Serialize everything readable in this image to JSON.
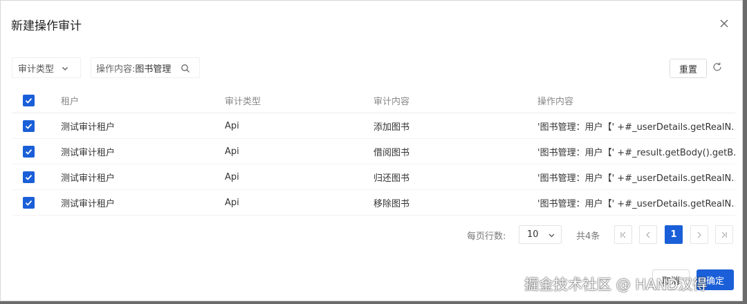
{
  "dialog": {
    "title": "新建操作审计"
  },
  "filters": {
    "type_label": "审计类型",
    "search_key": "操作内容:",
    "search_value": "图书管理"
  },
  "toolbar": {
    "reset_label": "重置"
  },
  "table": {
    "columns": [
      "租户",
      "审计类型",
      "审计内容",
      "操作内容"
    ],
    "rows": [
      {
        "checked": true,
        "tenant": "测试审计租户",
        "type": "Api",
        "content": "添加图书",
        "operation": "'图书管理：用户【' +#_userDetails.getRealN..."
      },
      {
        "checked": true,
        "tenant": "测试审计租户",
        "type": "Api",
        "content": "借阅图书",
        "operation": "'图书管理：用户【' +#_result.getBody().getB..."
      },
      {
        "checked": true,
        "tenant": "测试审计租户",
        "type": "Api",
        "content": "归还图书",
        "operation": "'图书管理：用户【' +#_userDetails.getRealN..."
      },
      {
        "checked": true,
        "tenant": "测试审计租户",
        "type": "Api",
        "content": "移除图书",
        "operation": "'图书管理：用户【' +#_userDetails.getRealN..."
      }
    ]
  },
  "pagination": {
    "page_size_label": "每页行数:",
    "page_size": "10",
    "total": "共4条",
    "current_page": "1"
  },
  "footer": {
    "cancel_label": "取消",
    "ok_label": "确定"
  },
  "watermark": "掘金技术社区 @ HAND汉得",
  "colors": {
    "primary": "#1a5fd8"
  },
  "icons": [
    "close-icon",
    "chevron-down-icon",
    "search-icon",
    "refresh-icon",
    "check-icon",
    "first-page-icon",
    "prev-page-icon",
    "next-page-icon",
    "last-page-icon"
  ]
}
